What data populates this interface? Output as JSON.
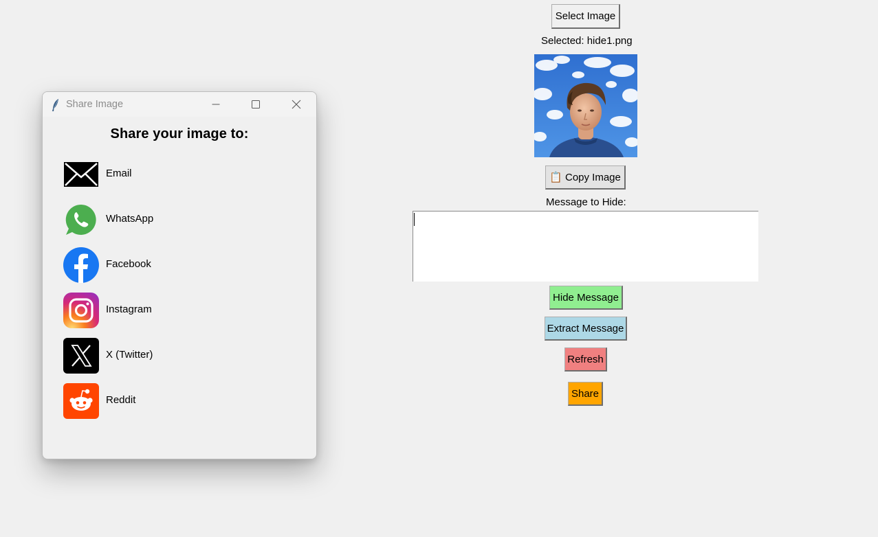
{
  "main": {
    "select_button": "Select Image",
    "selected_text": "Selected: hide1.png",
    "copy_button": "📋 Copy Image",
    "message_label": "Message to Hide:",
    "message_value": "",
    "hide_button": "Hide Message",
    "extract_button": "Extract Message",
    "refresh_button": "Refresh",
    "share_button": "Share"
  },
  "share_dialog": {
    "title": "Share Image",
    "heading": "Share your image to:",
    "options": [
      {
        "label": "Email",
        "icon": "email-icon"
      },
      {
        "label": "WhatsApp",
        "icon": "whatsapp-icon"
      },
      {
        "label": "Facebook",
        "icon": "facebook-icon"
      },
      {
        "label": "Instagram",
        "icon": "instagram-icon"
      },
      {
        "label": "X (Twitter)",
        "icon": "x-twitter-icon"
      },
      {
        "label": "Reddit",
        "icon": "reddit-icon"
      }
    ]
  },
  "colors": {
    "hide_button": "#90ee90",
    "extract_button": "#add8e6",
    "refresh_button": "#f08080",
    "share_button": "#ffa500",
    "background": "#f0f0f0"
  }
}
